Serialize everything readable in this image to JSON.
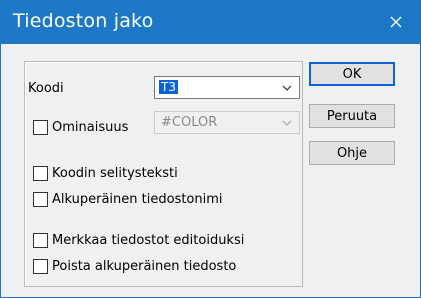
{
  "dialog": {
    "title": "Tiedoston jako",
    "close_icon": "close-icon"
  },
  "form": {
    "code_label": "Koodi",
    "code_value": "T3",
    "property_label": "Ominaisuus",
    "property_value": "#COLOR",
    "options": [
      {
        "label": "Koodin selitysteksti",
        "checked": false
      },
      {
        "label": "Alkuperäinen tiedostonimi",
        "checked": false
      },
      {
        "label": "Merkkaa tiedostot editoiduksi",
        "checked": false
      },
      {
        "label": "Poista alkuperäinen tiedosto",
        "checked": false
      }
    ],
    "property_checked": false
  },
  "buttons": {
    "ok": "OK",
    "cancel": "Peruuta",
    "help": "Ohje"
  },
  "colors": {
    "titlebar": "#1e78c8",
    "selection": "#0a64d8"
  }
}
